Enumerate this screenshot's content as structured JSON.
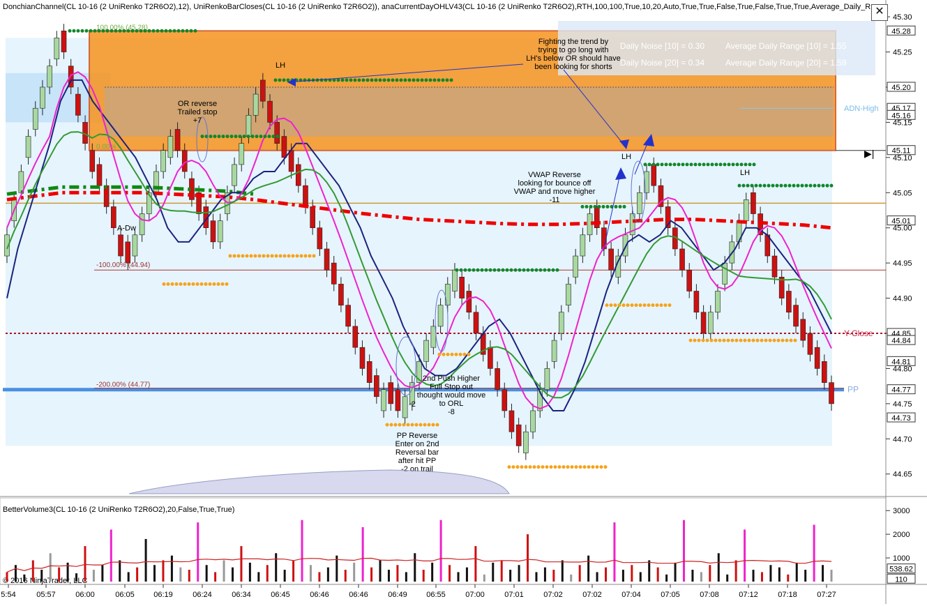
{
  "header": {
    "title": "DonchianChannel(CL 10-16 (2 UniRenko T2R6O2),12), UniRenkoBarCloses(CL 10-16 (2 UniRenko T2R6O2)), anaCurrentDayOHLV43(CL 10-16 (2 UniRenko T2R6O2),RTH,100,100,True,10,20,Auto,True,True,False,True,False,True,True,Average_Daily_R",
    "close_label": "✕"
  },
  "volume_panel": {
    "title": "BetterVolume3(CL 10-16 (2 UniRenko T2R6O2),20,False,True,True)",
    "copyright": "© 2016 NinjaTrader, LLC",
    "y_ticks": [
      "3000",
      "2000",
      "1000"
    ],
    "last_value_labels": [
      "538.62",
      "110"
    ]
  },
  "info_panel": {
    "rows": [
      {
        "left": "Daily Noise [10] = 0.30",
        "right": "Average Daily Range [10] = 1.55"
      },
      {
        "left": "Daily Noise [20] = 0.34",
        "right": "Average Daily Range [20] = 1.59"
      }
    ]
  },
  "price_axis": {
    "ticks": [
      "45.30",
      "45.25",
      "45.20",
      "45.15",
      "45.10",
      "45.05",
      "45.00",
      "44.95",
      "44.90",
      "44.85",
      "44.80",
      "44.75",
      "44.70",
      "44.65"
    ],
    "value_labels": [
      "45.28",
      "45.20",
      "45.17",
      "45.16",
      "45.11",
      "45.01",
      "44.85",
      "44.84",
      "44.81",
      "44.77",
      "44.73"
    ]
  },
  "time_axis": {
    "labels": [
      "5:54",
      "05:57",
      "06:00",
      "06:05",
      "06:19",
      "06:24",
      "06:34",
      "06:45",
      "06:46",
      "06:46",
      "06:49",
      "06:55",
      "07:00",
      "07:01",
      "07:02",
      "07:02",
      "07:04",
      "07:05",
      "07:08",
      "07:12",
      "07:18",
      "07:27"
    ]
  },
  "level_labels": {
    "pct_100": "100.00% (45.28)",
    "pct_0": "0.00%",
    "pct_neg100": "-100.00% (44.94)",
    "pct_neg200": "-200.00% (44.77)",
    "adn_high": "ADN-High",
    "y_close": "Y-Close",
    "pp": "PP",
    "a_dw": "A-Dw"
  },
  "annotations": [
    {
      "id": "or-reverse",
      "lines": [
        "OR reverse",
        "Trailed stop",
        "+7"
      ]
    },
    {
      "id": "fighting-trend",
      "lines": [
        "Fighting the trend by",
        "trying to go long with",
        "LH's below OR should have",
        "been looking for shorts"
      ]
    },
    {
      "id": "vwap-reverse",
      "lines": [
        "VWAP Reverse",
        "looking for bounce off",
        "VWAP and move higher",
        "-11"
      ]
    },
    {
      "id": "second-push",
      "lines": [
        "2nd Push Higher",
        "Full Stop out",
        "thought would move",
        "to ORL",
        "-8"
      ]
    },
    {
      "id": "pp-reverse",
      "lines": [
        "PP Reverse",
        "Enter on 2nd",
        "Reversal bar",
        "after hit PP",
        "-2 on trail"
      ]
    },
    {
      "id": "minus-two",
      "lines": [
        "-2"
      ]
    },
    {
      "id": "lh-1",
      "lines": [
        "LH"
      ]
    },
    {
      "id": "lh-2",
      "lines": [
        "LH"
      ]
    },
    {
      "id": "lh-3",
      "lines": [
        "LH"
      ]
    }
  ],
  "colors": {
    "up_bar": "#a8d8a0",
    "down_bar": "#cc1111",
    "or_zone": "#f7931e",
    "light_zone": "#d6ecfb",
    "vwap_red": "#ee0000",
    "prev_vwap_green": "#118811",
    "donchian": "#1a237e",
    "magenta_ma": "#ee22cc",
    "green_ma": "#339933",
    "dots_green": "#11862b",
    "dots_orange": "#f5a31a",
    "pp_line": "#4a90e2",
    "yclose": "#aa1122"
  },
  "chart_data": {
    "type": "candlestick",
    "instrument": "CL 10-16 (2 UniRenko T2R6O2)",
    "ylim": [
      44.62,
      45.31
    ],
    "levels": {
      "or_high": 45.28,
      "or_low": 45.11,
      "adn_high": 45.17,
      "pct_100": 45.28,
      "pct_neg100": 44.94,
      "pct_neg200": 44.77,
      "y_close": 44.85,
      "pp": 44.77,
      "orange_level": 45.035
    },
    "closes": [
      44.99,
      45.04,
      45.08,
      45.13,
      45.17,
      45.2,
      45.23,
      45.27,
      45.25,
      45.2,
      45.16,
      45.12,
      45.08,
      45.06,
      45.03,
      45.0,
      44.96,
      44.95,
      44.99,
      45.02,
      45.05,
      45.08,
      45.11,
      45.13,
      45.11,
      45.08,
      45.04,
      45.02,
      45.0,
      44.98,
      45.01,
      45.05,
      45.09,
      45.12,
      45.16,
      45.19,
      45.18,
      45.15,
      45.12,
      45.1,
      45.08,
      45.06,
      45.03,
      45.0,
      44.97,
      44.94,
      44.92,
      44.89,
      44.86,
      44.83,
      44.8,
      44.78,
      44.76,
      44.77,
      44.75,
      44.74,
      44.76,
      44.78,
      44.81,
      44.84,
      44.86,
      44.89,
      44.92,
      44.94,
      44.9,
      44.88,
      44.85,
      44.82,
      44.8,
      44.77,
      44.74,
      44.71,
      44.69,
      44.71,
      44.74,
      44.77,
      44.8,
      44.84,
      44.88,
      44.92,
      44.96,
      44.99,
      45.02,
      45.0,
      44.97,
      44.94,
      44.96,
      44.99,
      45.02,
      45.05,
      45.08,
      45.06,
      45.03,
      45.0,
      44.97,
      44.94,
      44.91,
      44.88,
      44.85,
      44.88,
      44.91,
      44.95,
      44.98,
      45.01,
      45.04,
      45.02,
      44.99,
      44.96,
      44.93,
      44.9,
      44.88,
      44.86,
      44.84,
      44.82,
      44.8,
      44.78,
      44.75
    ],
    "donchian": [
      44.9,
      44.97,
      45.02,
      45.07,
      45.12,
      45.18,
      45.21,
      45.21,
      45.18,
      45.16,
      45.14,
      45.12,
      45.1,
      45.07,
      45.04,
      45.0,
      44.98,
      44.98,
      45.0,
      45.02,
      45.04,
      45.05,
      45.05,
      45.07,
      45.08,
      45.08,
      45.1,
      45.12,
      45.12,
      45.1,
      45.08,
      45.06,
      45.03,
      45.0,
      44.96,
      44.93,
      44.9,
      44.86,
      44.83,
      44.8,
      44.79,
      44.79,
      44.8,
      44.82,
      44.84,
      44.86,
      44.87,
      44.85,
      44.82,
      44.79,
      44.76,
      44.74,
      44.74,
      44.77,
      44.81,
      44.86,
      44.91,
      44.95,
      44.98,
      44.99,
      44.98,
      44.99,
      45.01,
      45.0,
      44.98,
      44.96,
      44.94,
      44.95,
      44.97,
      45.0,
      45.0,
      44.99,
      44.97,
      44.95,
      44.93,
      44.91,
      44.88,
      44.85
    ],
    "vwap": [
      45.04,
      45.045,
      45.05,
      45.05,
      45.05,
      45.05,
      45.048,
      45.046,
      45.044,
      45.04,
      45.035,
      45.03,
      45.025,
      45.02,
      45.016,
      45.012,
      45.01,
      45.008,
      45.006,
      45.005,
      45.005,
      45.006,
      45.008,
      45.01,
      45.012,
      45.012,
      45.01,
      45.008,
      45.006,
      45.004,
      45.0
    ],
    "volume": [
      400,
      700,
      300,
      900,
      500,
      1200,
      600,
      800,
      350,
      1500,
      500,
      700,
      2200,
      900,
      400,
      600,
      1800,
      700,
      900,
      1100,
      600,
      500,
      2500,
      700,
      400,
      900,
      600,
      1500,
      800,
      400,
      700,
      1200,
      500,
      900,
      2600,
      700,
      400,
      600,
      1100,
      500,
      800,
      2300,
      600,
      900,
      500,
      700,
      400,
      1200,
      500,
      800,
      2600,
      700,
      400,
      600,
      1500,
      300,
      800,
      900,
      500,
      700,
      2000,
      400,
      600,
      500,
      900,
      300,
      700,
      1100,
      400,
      600,
      2500,
      500,
      700,
      400,
      900,
      600,
      300,
      800,
      2600,
      500,
      400,
      700,
      1200,
      300,
      900,
      2200,
      500,
      400,
      700,
      600,
      300,
      800,
      500,
      2400,
      700,
      500
    ]
  }
}
